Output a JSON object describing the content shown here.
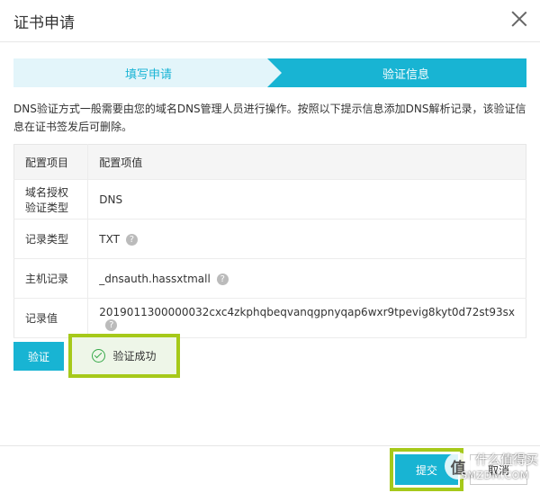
{
  "header": {
    "title": "证书申请"
  },
  "steps": {
    "step1": "填写申请",
    "step2": "验证信息"
  },
  "description": "DNS验证方式一般需要由您的域名DNS管理人员进行操作。按照以下提示信息添加DNS解析记录，该验证信息在证书签发后可删除。",
  "table": {
    "headers": [
      "配置项目",
      "配置项值"
    ],
    "rows": [
      {
        "label": "域名授权验证类型",
        "value": "DNS"
      },
      {
        "label": "记录类型",
        "value": "TXT"
      },
      {
        "label": "主机记录",
        "value": "_dnsauth.hassxtmall"
      },
      {
        "label": "记录值",
        "value": "2019011300000032cxc4zkphqbeqvanqgpnyqap6wxr9tpevig8kyt0d72st93sx"
      }
    ],
    "help_icon": "?"
  },
  "actions": {
    "verify_label": "验证",
    "success_text": "验证成功",
    "submit_label": "提交",
    "cancel_label": "取消"
  },
  "watermark": {
    "logo": "值",
    "text1": "什么值得买",
    "text2": "SMZDM.COM"
  },
  "colors": {
    "accent": "#18b4d3",
    "highlight": "#a6c91a",
    "success": "#37a94a"
  }
}
